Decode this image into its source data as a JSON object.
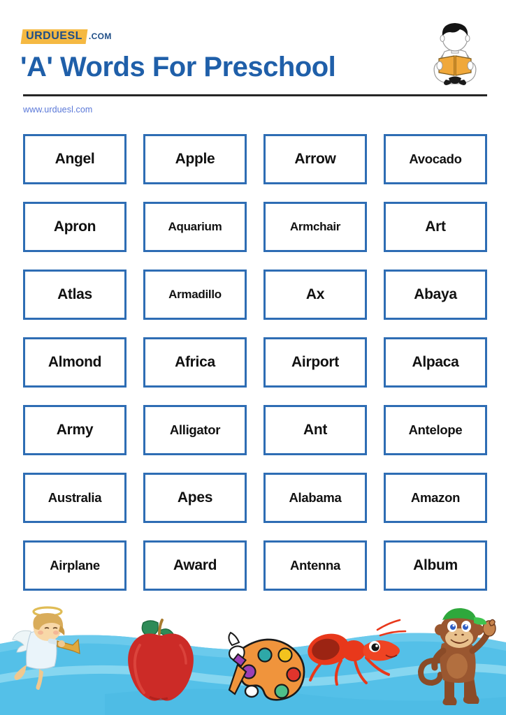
{
  "header": {
    "logo_text": "URDUESL",
    "logo_tld": ".COM",
    "title": "'A' Words For Preschool",
    "site_url": "www.urduesl.com",
    "reader_icon": "boy-reading-book-icon"
  },
  "colors": {
    "title_blue": "#1F5FA9",
    "cell_border_blue": "#2E6DB4",
    "logo_yellow": "#F5B942",
    "logo_navy": "#1F4E87",
    "url_blue": "#5A78D8",
    "divider_black": "#262626",
    "wave_blue": "#54C0E8",
    "wave_blue_light": "#7FD2EE",
    "apple_red": "#CC2B27",
    "ant_red": "#E8381B",
    "monkey_brown": "#8A4B28",
    "palette_orange": "#F0943C"
  },
  "grid": {
    "columns": 4,
    "rows": 7,
    "words": [
      "Angel",
      "Apple",
      "Arrow",
      "Avocado",
      "Apron",
      "Aquarium",
      "Armchair",
      "Art",
      "Atlas",
      "Armadillo",
      "Ax",
      "Abaya",
      "Almond",
      "Africa",
      "Airport",
      "Alpaca",
      "Army",
      "Alligator",
      "Ant",
      "Antelope",
      "Australia",
      "Apes",
      "Alabama",
      "Amazon",
      "Airplane",
      "Award",
      "Antenna",
      "Album"
    ]
  },
  "footer": {
    "illustrations": [
      "angel-with-trumpet-icon",
      "red-apple-icon",
      "art-palette-with-brush-icon",
      "red-ant-icon",
      "monkey-ape-icon"
    ],
    "background": "blue-wave-band"
  }
}
